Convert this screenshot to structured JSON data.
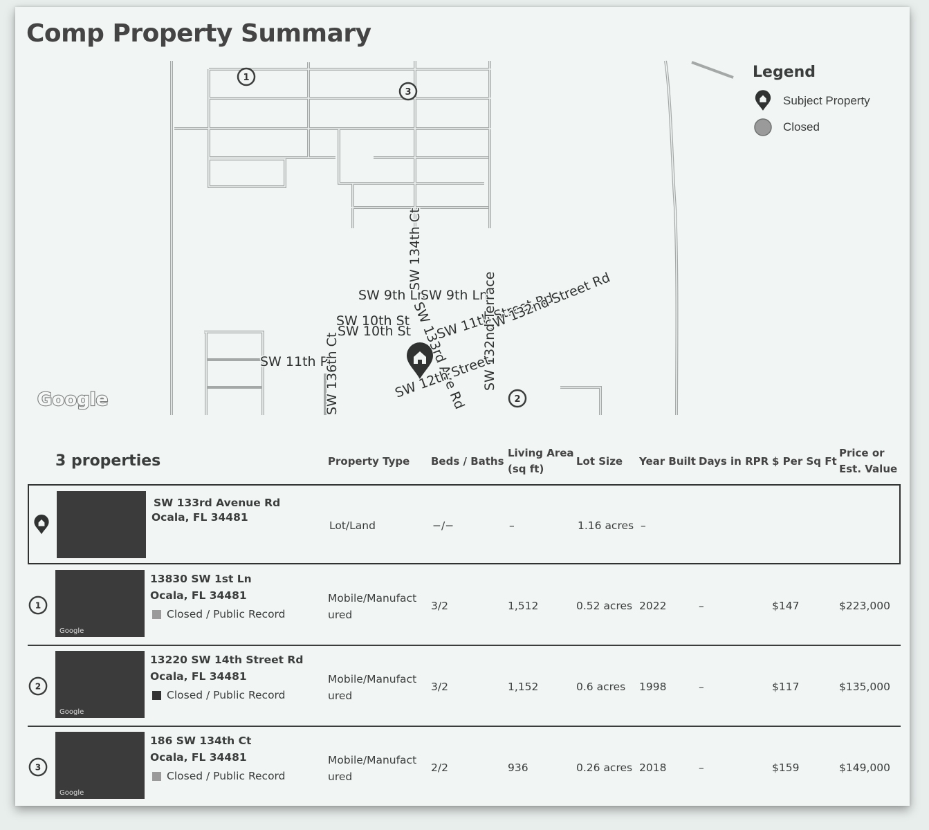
{
  "page": {
    "title": "Comp Property Summary"
  },
  "map": {
    "streets": [
      "SW 134th Ct",
      "SW 9th Ln",
      "SW 9th Ln",
      "SW 10th St",
      "SW 10th St",
      "SW 11th Street Rd",
      "SW 132nd Street Rd",
      "SW 132nd Terrace",
      "SW 11th Pl",
      "SW 136th Ct",
      "SW 133rd Ave Rd",
      "SW 12th Street"
    ],
    "pins": [
      "1",
      "2",
      "3"
    ],
    "provider": "Google"
  },
  "legend": {
    "title": "Legend",
    "items": [
      {
        "label": "Subject Property",
        "icon": "subject-pin-icon"
      },
      {
        "label": "Closed",
        "icon": "closed-dot-icon",
        "color": "#9a9a9a"
      }
    ]
  },
  "table": {
    "count_label": "3 properties",
    "columns": {
      "type": "Property Type",
      "beds": "Beds / Baths",
      "living1": "Living Area",
      "living2": "(sq ft)",
      "lot": "Lot Size",
      "year": "Year Built",
      "days": "Days in RPR",
      "ppsf": "$ Per Sq Ft",
      "price1": "Price or",
      "price2": "Est. Value"
    },
    "subject": {
      "address1": "SW 133rd Avenue Rd",
      "address2": "Ocala, FL 34481",
      "type": "Lot/Land",
      "beds": "−/−",
      "living": "–",
      "lot": "1.16 acres",
      "year": "–"
    },
    "rows": [
      {
        "num": "1",
        "address1": "13830 SW 1st Ln",
        "address2": "Ocala, FL 34481",
        "status": "Closed / Public Record",
        "status_color": "#9a9a9a",
        "type1": "Mobile/Manufact",
        "type2": "ured",
        "beds": "3/2",
        "living": "1,512",
        "lot": "0.52 acres",
        "year": "2022",
        "days": "–",
        "ppsf": "$147",
        "price": "$223,000",
        "thumb_label": "Google"
      },
      {
        "num": "2",
        "address1": "13220 SW 14th Street Rd",
        "address2": "Ocala, FL 34481",
        "status": "Closed / Public Record",
        "status_color": "#333333",
        "type1": "Mobile/Manufact",
        "type2": "ured",
        "beds": "3/2",
        "living": "1,152",
        "lot": "0.6 acres",
        "year": "1998",
        "days": "–",
        "ppsf": "$117",
        "price": "$135,000",
        "thumb_label": "Google"
      },
      {
        "num": "3",
        "address1": "186 SW 134th Ct",
        "address2": "Ocala, FL 34481",
        "status": "Closed / Public Record",
        "status_color": "#9a9a9a",
        "type1": "Mobile/Manufact",
        "type2": "ured",
        "beds": "2/2",
        "living": "936",
        "lot": "0.26 acres",
        "year": "2018",
        "days": "–",
        "ppsf": "$159",
        "price": "$149,000",
        "thumb_label": "Google"
      }
    ]
  }
}
